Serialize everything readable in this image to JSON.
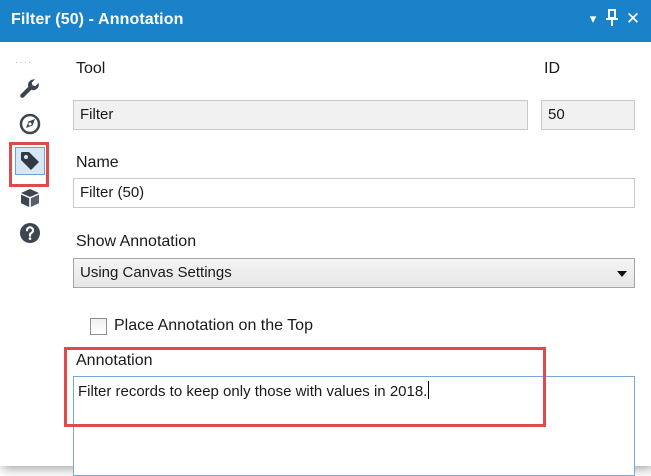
{
  "window": {
    "title": "Filter (50) - Annotation",
    "menu_glyph": "▾",
    "pin_glyph": "⊥",
    "close_glyph": "✕"
  },
  "rail": {
    "grip": "····",
    "items": [
      {
        "name": "configuration",
        "icon": "wrench-icon"
      },
      {
        "name": "layout",
        "icon": "compass-icon"
      },
      {
        "name": "annotation",
        "icon": "tag-icon",
        "active": true
      },
      {
        "name": "metainfo",
        "icon": "box-icon"
      },
      {
        "name": "help",
        "icon": "help-icon"
      }
    ]
  },
  "form": {
    "tool_label": "Tool",
    "tool_value": "Filter",
    "id_label": "ID",
    "id_value": "50",
    "name_label": "Name",
    "name_value": "Filter (50)",
    "show_annotation_label": "Show Annotation",
    "show_annotation_selected": "Using Canvas Settings",
    "place_top_label": "Place Annotation on the Top",
    "place_top_checked": false,
    "annotation_label": "Annotation",
    "annotation_text": "Filter records to keep only those with values in 2018."
  },
  "colors": {
    "titlebar": "#1a82c9",
    "highlight": "#e04a4a",
    "icon": "#3d4650"
  }
}
